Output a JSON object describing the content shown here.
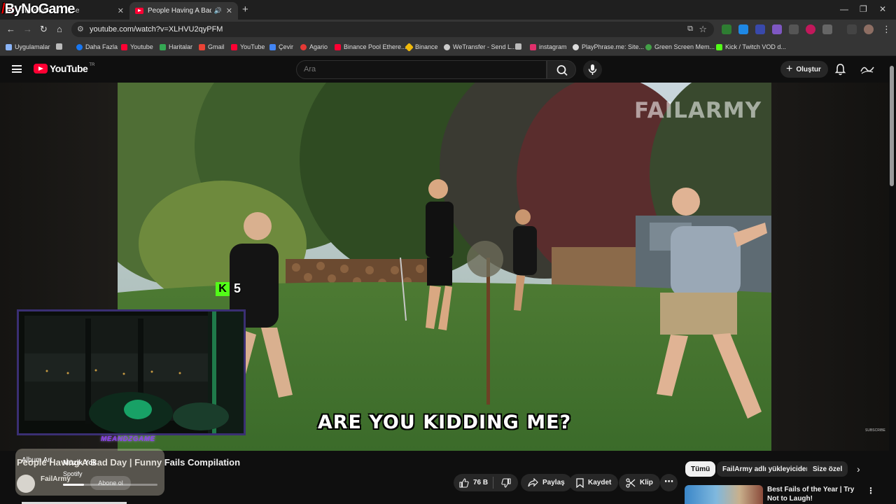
{
  "browser": {
    "tabs": [
      {
        "title": "FailArmy - YouTube",
        "active": false
      },
      {
        "title": "People Having A Bad Day | Funny Fails Compilation",
        "active": true
      }
    ],
    "brand_overlay": "ByNoGame",
    "new_tab": "+",
    "url": "youtube.com/watch?v=XLHVU2qyPFM",
    "bookmarks": [
      {
        "label": "Uygulamalar",
        "color": "#8ab4f8"
      },
      {
        "label": "Daha Fazla",
        "color": "#1877f2"
      },
      {
        "label": "Youtube",
        "color": "#ff0033"
      },
      {
        "label": "Haritalar",
        "color": "#34a853"
      },
      {
        "label": "Gmail",
        "color": "#ea4335"
      },
      {
        "label": "YouTube",
        "color": "#ff0033"
      },
      {
        "label": "Çevir",
        "color": "#4285f4"
      },
      {
        "label": "Agario",
        "color": "#e53935"
      },
      {
        "label": "Binance Pool Ethere...",
        "color": "#ff0033"
      },
      {
        "label": "Binance",
        "color": "#f0b90b"
      },
      {
        "label": "WeTransfer - Send L...",
        "color": "#cccccc"
      },
      {
        "label": "instagram",
        "color": "#e1306c"
      },
      {
        "label": "PlayPhrase.me: Site...",
        "color": "#dddddd"
      },
      {
        "label": "Green Screen Mem...",
        "color": "#43a047"
      },
      {
        "label": "Kick / Twitch VOD d...",
        "color": "#53fc18"
      }
    ]
  },
  "youtube": {
    "logo_text": "YouTube",
    "logo_region": "TR",
    "search_placeholder": "Ara",
    "create_label": "Oluştur",
    "video": {
      "caption": "ARE YOU KIDDING ME?",
      "watermark": "FAILARMY",
      "kick_viewers": "5",
      "webcam_tag": "MEANDZGAME",
      "subscribe_mini": "SUBSCRIBE"
    },
    "title": "People Having A Bad Day | Funny Fails Compilation",
    "channel": "FailArmy",
    "actions": {
      "likes": "76 B",
      "share": "Paylaş",
      "save": "Kaydet",
      "clip": "Klip",
      "more": "⋯"
    },
    "chips": [
      {
        "label": "Tümü",
        "selected": true
      },
      {
        "label": "FailArmy adlı yükleyiciden",
        "selected": false
      },
      {
        "label": "Size özel",
        "selected": false
      }
    ],
    "recommended": {
      "title": "Best Fails of the Year | Try Not to Laugh!"
    }
  },
  "spotify_widget": {
    "album_art_alt": "Album Art",
    "song": "Müzik Yok",
    "app": "Spotify",
    "subscribe": "Abone ol",
    "progress": 0.22
  }
}
